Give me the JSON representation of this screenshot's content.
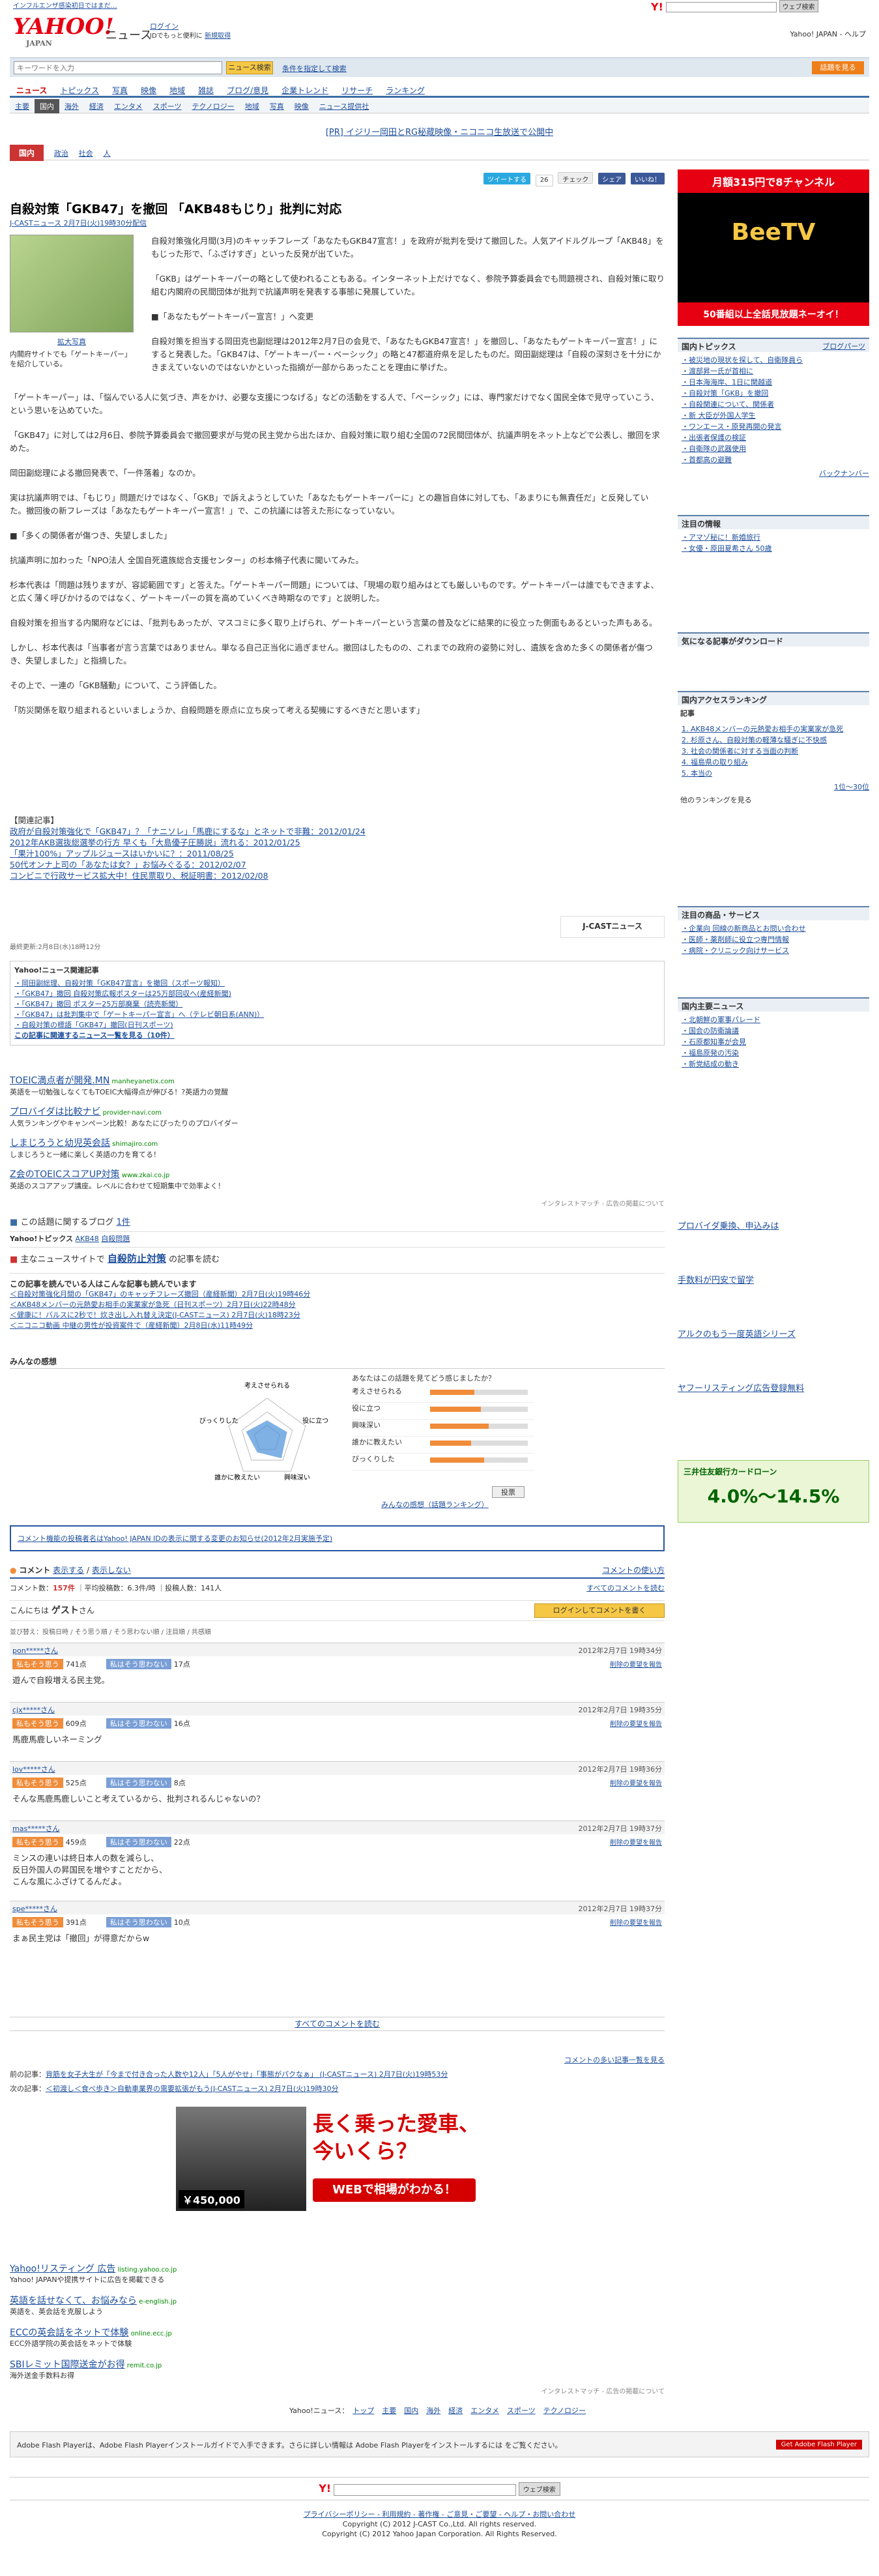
{
  "header": {
    "top_link": "インフルエンザ感染初日ではまだ…",
    "logo_text": "YAHOO!",
    "logo_sub": "JAPAN",
    "service": "ニュース",
    "login": "ログイン",
    "signup": "新規取得",
    "login_note": "IDでもっと便利に",
    "top_search_button": "ウェブ検索",
    "top_links": "Yahoo! JAPAN - ヘルプ",
    "search_placeholder": "キーワードを入力",
    "search_button": "ニュース検索",
    "search_option": "条件を指定して検索",
    "right_button": "話題を見る"
  },
  "gnav": [
    "ニュース",
    "トピックス",
    "写真",
    "映像",
    "地域",
    "雑誌",
    "ブログ/意見",
    "企業トレンド",
    "リサーチ",
    "ランキング"
  ],
  "subnav": [
    "主要",
    "国内",
    "海外",
    "経済",
    "エンタメ",
    "スポーツ",
    "テクノロジー",
    "地域",
    "写真",
    "映像",
    "ニュース提供社"
  ],
  "pr": "[PR] イジリー岡田とRG秘蔵映像・ニコニコ生放送で公開中",
  "crumb": {
    "cat": "国内",
    "items": [
      "政治",
      "社会",
      "人"
    ]
  },
  "social": {
    "tweet": "ツイートする",
    "tweet_count": "26",
    "check": "チェック",
    "share": "シェア",
    "like": "いいね！"
  },
  "article": {
    "headline": "自殺対策「GKB47」を撤回 「AKB48もじり」批判に対応",
    "source": "J-CASTニュース 2月7日(火)19時30分配信",
    "photo_link": "拡大写真",
    "photo_caption": "内閣府サイトでも「ゲートキーパー」を紹介している。",
    "paras1": [
      "自殺対策強化月間(3月)のキャッチフレーズ「あなたもGKB47宣言！」を政府が批判を受けて撤回した。人気アイドルグループ「AKB48」をもじった形で、「ふざけすぎ」といった反発が出ていた。",
      "「GKB」はゲートキーパーの略として使われることもある。インターネット上だけでなく、参院予算委員会でも問題視され、自殺対策に取り組む内閣府の民間団体が批判で抗議声明を発表する事態に発展していた。",
      "■「あなたもゲートキーパー宣言！」へ変更",
      "自殺対策を担当する岡田克也副総理は2012年2月7日の会見で、「あなたもGKB47宣言！」を撤回し、「あなたもゲートキーパー宣言！」にすると発表した。「GKB47は、「ゲートキーパー・ベーシック」の略と47都道府県を足したものだ。岡田副総理は「自殺の深刻さを十分にかきまえていないのではないかといった指摘が一部からあったことを理由に挙げた。"
    ],
    "paras2": [
      "「ゲートキーパー」は、「悩んでいる人に気づき、声をかけ、必要な支援につなげる」などの活動をする人で、「ベーシック」には、専門家だけでなく国民全体で見守っていこう、という思いを込めていた。",
      "「GKB47」に対しては2月6日、参院予算委員会で撤回要求が与党の民主党から出たほか、自殺対策に取り組む全国の72民間団体が、抗議声明をネット上などで公表し、撤回を求めた。",
      "岡田副総理による撤回発表で、「一件落着」なのか。",
      "実は抗議声明では、「もじり」問題だけではなく、「GKB」で訴えようとしていた「あなたもゲートキーパーに」との趣旨自体に対しても、「あまりにも無責任だ」と反発していた。撤回後の新フレーズは「あなたもゲートキーパー宣言！」で、この抗議には答えた形になっていない。",
      "■「多くの関係者が傷つき、失望しました」",
      "抗議声明に加わった「NPO法人 全国自死遺族総合支援センター」の杉本脩子代表に聞いてみた。",
      "杉本代表は「問題は残りますが、容認範囲です」と答えた。「ゲートキーパー問題」については、「現場の取り組みはとても厳しいものです。ゲートキーパーは誰でもできますよ、と広く薄く呼びかけるのではなく、ゲートキーパーの質を高めていくべき時期なのです」と説明した。",
      "自殺対策を担当する内閣府などには、「批判もあったが、マスコミに多く取り上げられ、ゲートキーパーという言葉の普及などに結果的に役立った側面もあるといった声もある。",
      "しかし、杉本代表は「当事者が言う言葉ではありません。単なる自己正当化に過ぎません。撤回はしたものの、これまでの政府の姿勢に対し、遺族を含めた多くの関係者が傷つき、失望しました」と指摘した。",
      "その上で、一連の「GKB騒動」について、こう評価した。",
      "「防災関係を取り組まれるといいましょうか、自殺問題を原点に立ち戻って考える契機にするべきだと思います」"
    ],
    "related_head": "【関連記事】",
    "related": [
      "政府が自殺対策強化で「GKB47」？「ナニソレ」「馬鹿にするな」とネットで非難：2012/01/24",
      "2012年AKB選抜総選挙の行方 早くも「大島優子圧勝説」流れる：2012/01/25",
      "「果汁100%」アップルジュースはいかいに？：2011/08/25",
      "50代オンナ上司の「あなたは女？」お悩みぐるる：2012/02/07",
      "コンビニで行政サービス拡大中！住民票取り、税証明書：2012/02/08"
    ],
    "jcast": "J-CASTニュース",
    "updated": "最終更新:2月8日(水)18時12分"
  },
  "related_news": {
    "title": "Yahoo!ニュース関連記事",
    "items": [
      "岡田副総理、自殺対策「GKB47宣言」を撤回（スポーツ報知）",
      "「GKB47」撤回 自殺対策広報ポスターは25万部回収へ(産経新聞)",
      "「GKB47」撤回 ポスター25万部廃棄（読売新聞）",
      "「GKB47」は批判集中で「ゲートキーパー宣言」へ（テレビ朝日系(ANN)）",
      "自殺対策の標語「GKB47」撤回(日刊スポーツ)"
    ],
    "more": "この記事に関連するニュース一覧を見る（10件）"
  },
  "ads": [
    {
      "title": "TOEIC満点者が開発.MN",
      "url": "manheyanetix.com",
      "desc": "英語を一切勉強しなくてもTOEIC大幅得点が伸びる！?英語力の覚醒"
    },
    {
      "title": "プロバイダは比較ナビ",
      "url": "provider-navi.com",
      "desc": "人気ランキングやキャンペーン比較！あなたにぴったりのプロバイダー"
    },
    {
      "title": "しまじろうと幼児英会話",
      "url": "shimajiro.com",
      "desc": "しまじろうと一緒に楽しく英語の力を育てる！"
    },
    {
      "title": "Z会のTOEICスコアUP対策",
      "url": "www.zkai.co.jp",
      "desc": "英語のスコアアップ講座。レベルに合わせて短期集中で効率よく！"
    }
  ],
  "ad_note": "インタレストマッチ - 広告の掲載について",
  "blog": {
    "label": "この話題に関するブログ",
    "count": "1件"
  },
  "yt": {
    "label": "Yahoo!トピックス",
    "items": [
      "AKB48",
      "自殺問題"
    ]
  },
  "taisaku": {
    "label": "主なニュースサイトで",
    "keyword": "自殺防止対策",
    "suffix": "の記事を読む"
  },
  "also_read": {
    "title": "この記事を読んでいる人はこんな記事も読んでいます",
    "items": [
      "自殺対策強化月間の「GKB47」のキャッチフレーズ撤回（産経新聞）2月7日(火)19時46分",
      "AKB48メンバーの元熱愛お相手の実業家が急死（日刊スポーツ）2月7日(火)22時48分",
      "健康に！バルスに2秒で！炊き出し入れ替え決定(J-CASTニュース) 2月7日(火)18時23分",
      "ニコニコ動画 中継の男性が投資案件で（産経新聞）2月8日(水)11時49分"
    ]
  },
  "kansou": {
    "title": "みんなの感想",
    "question": "あなたはこの話題を見てどう感じましたか？",
    "axes": [
      "考えさせられる",
      "役に立つ",
      "興味深い",
      "誰かに教えたい",
      "びっくりした"
    ],
    "values": [
      0.45,
      0.52,
      0.6,
      0.42,
      0.55
    ],
    "vote_button": "投票",
    "ranking_link": "みんなの感想（話題ランキング）"
  },
  "notice": "コメント機能の投稿者名はYahoo! JAPAN IDの表示に関する変更のお知らせ(2012年2月実施予定)",
  "comments_section": {
    "title": "コメント",
    "show": "表示する",
    "hide": "表示しない",
    "howto": "コメントの使い方",
    "stat_label": "コメント数：",
    "count": "157件",
    "avg": "平均投稿数：6.3件/時",
    "posters": "投稿人数：141人",
    "all_link": "すべてのコメントを読む",
    "guest_label": "こんにちは",
    "guest_name": "ゲスト",
    "guest_suffix": "さん",
    "login_button": "ログインしてコメントを書く",
    "sort": "並び替え：投稿日時 / そう思う順 / そう思わない順 / 注目順 / 共感順"
  },
  "comments": [
    {
      "user": "pon*****さん",
      "date": "2012年2月7日 19時34分",
      "agree": "741点",
      "disagree": "17点",
      "text": "遊んで自殺増える民主党。"
    },
    {
      "user": "cjx*****さん",
      "date": "2012年2月7日 19時35分",
      "agree": "609点",
      "disagree": "16点",
      "text": "馬鹿馬鹿しいネーミング"
    },
    {
      "user": "lov*****さん",
      "date": "2012年2月7日 19時36分",
      "agree": "525点",
      "disagree": "8点",
      "text": "そんな馬鹿馬鹿しいこと考えているから、批判されるんじゃないの？"
    },
    {
      "user": "mas*****さん",
      "date": "2012年2月7日 19時37分",
      "agree": "459点",
      "disagree": "22点",
      "text": "ミンスの連いは終日本人の数を減らし、\n反日外国人の昇国民を増やすことだから、\nこんな風にふざけてるんだよ。"
    },
    {
      "user": "spe*****さん",
      "date": "2012年2月7日 19時37分",
      "agree": "391点",
      "disagree": "10点",
      "text": "まぁ民主党は「撤回」が得意だからw"
    }
  ],
  "comment_labels": {
    "agree": "私もそう思う",
    "disagree": "私はそう思わない",
    "delete": "削除の要望を報告"
  },
  "all_comments": "すべてのコメントを読む",
  "prevnext": {
    "prev_label": "前の記事：",
    "prev": "背筋を女子大生が「今まで付き合った人数や12人」「5人がやせ」「事態がパクなぁ」 (J-CASTニュース) 2月7日(火)19時53分",
    "next_label": "次の記事：",
    "next": "＜初渡し＜食べ歩き＞自動車業界の需要拡張がもう(J-CASTニュース) 2月7日(火)19時30分",
    "rank_link": "コメントの多い記事一覧を見る"
  },
  "bigad": {
    "headline": "長く乗った愛車、",
    "headline2": "今いくら？",
    "price": "￥450,000",
    "cta": "WEBで相場がわかる！"
  },
  "bottom_ads": [
    {
      "title": "Yahoo!リスティング 広告",
      "url": "listing.yahoo.co.jp",
      "desc": "Yahoo! JAPANや提携サイトに広告を掲載できる"
    },
    {
      "title": "英語を話せなくて、お悩みなら",
      "url": "e-english.jp",
      "desc": "英語を、英会話を克服しよう"
    },
    {
      "title": "ECCの英会話をネットで体験",
      "url": "online.ecc.jp",
      "desc": "ECC外語学院の英会話をネットで体験"
    },
    {
      "title": "SBIレミット国際送金がお得",
      "url": "remit.co.jp",
      "desc": "海外送金手数料お得"
    }
  ],
  "bottom_ad_note": "インタレストマッチ - 広告の掲載について",
  "bottom_nav": [
    "トップ",
    "主要",
    "国内",
    "海外",
    "経済",
    "エンタメ",
    "スポーツ",
    "テクノロジー"
  ],
  "bottom_nav_label": "Yahoo!ニュース：",
  "flash": "Adobe Flash Playerは、Adobe Flash Playerインストールガイドで入手できます。さらに詳しい情報は Adobe Flash Playerをインストールするには をご覧ください。",
  "flash_badge": "Get Adobe Flash Player",
  "footer": {
    "search_button": "ウェブ検索",
    "links": "プライバシーポリシー - 利用規約 - 著作権 - ご意見・ご要望 - ヘルプ・お問い合わせ",
    "copyright": "Copyright (C) 2012 J-CAST Co.,Ltd. All rights reserved.",
    "copyright2": "Copyright (C) 2012 Yahoo Japan Corporation. All Rights Reserved."
  },
  "right": {
    "banner1": "月額315円で8チャンネル",
    "banner_brand": "BeeTV",
    "banner_tag": "50番組以上全話見放題ネーオイ！",
    "topics_title": "国内トピックス",
    "topics_more": "ブログパーツ",
    "topics": [
      "被災地の現状を探して、自衛隊員ら",
      "渡部昇一氏が首相に",
      "日本海海岸、1日に関越道",
      "自殺対策「GKB」を撤回",
      "自殺関連について、関係者",
      "新 大臣が外国人学生",
      "ワンエース・原発再開の発言",
      "出張者保護の検証",
      "自衛隊の武器使用",
      "首都高の避難"
    ],
    "topics_bkmk": "バックナンバー",
    "today": "注目の情報",
    "today_items": [
      "アマゾ秘に！新婚旅行",
      "女優・原田夏希さん 50歳"
    ],
    "dl_title": "気になる記事がダウンロード",
    "ranking_title": "国内アクセスランキング",
    "ranking_sub": "記事",
    "ranking": [
      "AKB48メンバーの元熱愛お相手の実業家が急死",
      "杉原さん、自殺対策の軽薄な騒ぎに不快感",
      "社会の関係者に対する当面の判断",
      "福島県の取り組み",
      "本当の"
    ],
    "ranking_more": "1位〜30位",
    "share": "他のランキングを見る",
    "yshop_title": "注目の商品・サービス",
    "yshop": [
      "企業向 回線の新商品とお問い合わせ",
      "医師・薬剤師に役立つ専門情報",
      "病院・クリニック向けサービス"
    ],
    "main_title": "国内主要ニュース",
    "main": [
      "北朝鮮の軍事パレード",
      "国会の防衛論議",
      "石原都知事が会見",
      "福島原発の汚染",
      "新党結成の動き"
    ],
    "right_ads": [
      "プロバイダ乗換、申込みは",
      "手数料が円安で留学",
      "アルクのもう一度英語シリーズ",
      "ヤフーリスティング広告登録無料"
    ],
    "ad2_text": "三井住友銀行カードローン",
    "ad2_rate": "4.0%～14.5%"
  }
}
